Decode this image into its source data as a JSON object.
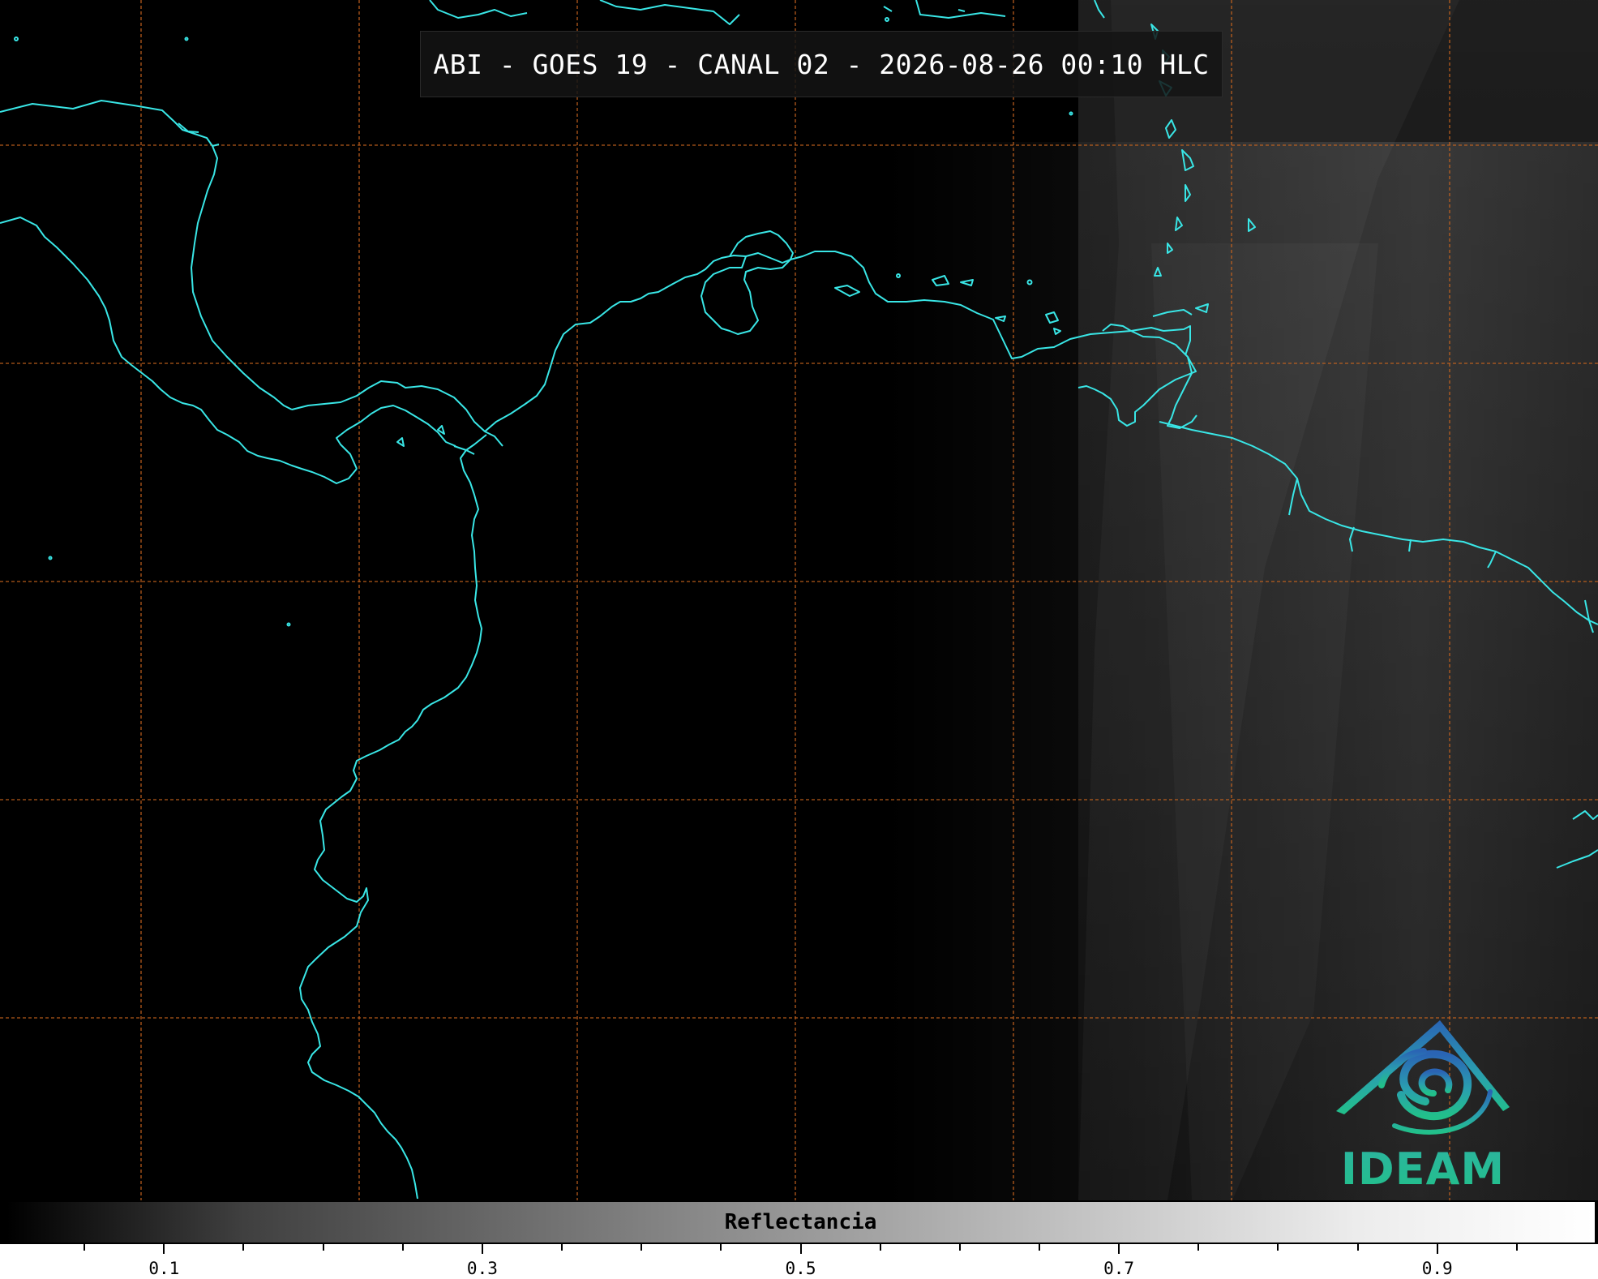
{
  "title": "ABI - GOES 19 - CANAL 02 - 2026-08-26 00:10 HLC",
  "logo": {
    "name": "ideam-logo",
    "text": "IDEAM"
  },
  "colorbar": {
    "label": "Reflectancia",
    "range": [
      0.0,
      1.0
    ],
    "ticks": [
      "0.1",
      "0.3",
      "0.5",
      "0.7",
      "0.9"
    ]
  },
  "colors": {
    "coastline": "#39e6e6",
    "gridlines": "#c8641e",
    "background": "#000000"
  }
}
